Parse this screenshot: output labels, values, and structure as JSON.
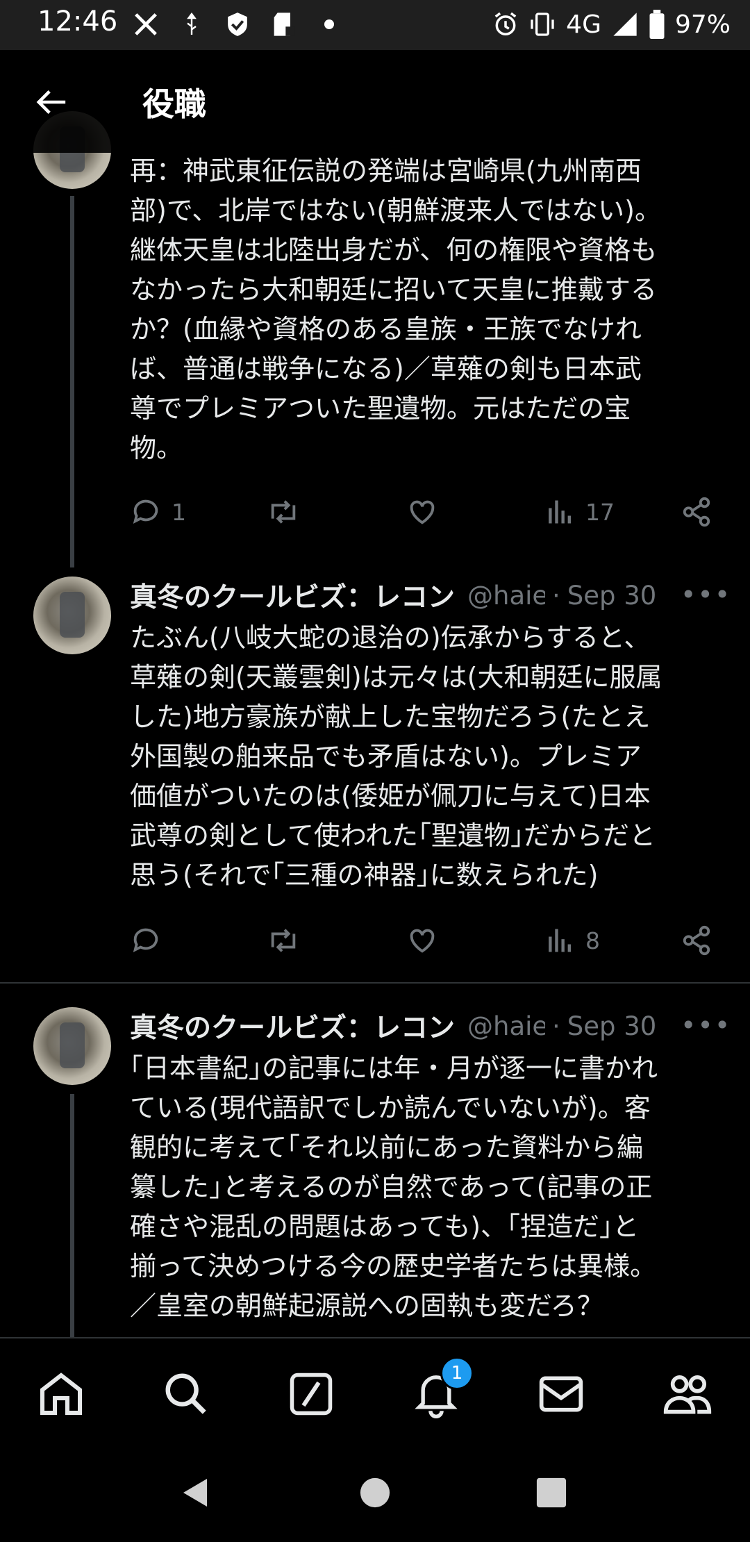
{
  "status_bar": {
    "time": "12:46",
    "network": "4G",
    "battery": "97%",
    "icons": [
      "x-logo-icon",
      "usb-icon",
      "shield-icon",
      "sdcard-icon",
      "dot-icon",
      "alarm-icon",
      "vibrate-icon",
      "signal-icon",
      "battery-icon"
    ]
  },
  "header": {
    "title": "役職",
    "back_icon": "arrow-left-icon"
  },
  "posts": [
    {
      "text": "再：神武東征伝説の発端は宮崎県(九州南西\n部)で、北岸ではない(朝鮮渡来人ではない)。\n継体天皇は北陸出身だが、何の権限や資格も\nなかったら大和朝廷に招いて天皇に推戴する\nか？(血縁や資格のある皇族・王族でなけれ\nば、普通は戦争になる)／草薙の剣も日本武\n尊でプレミアついた聖遺物。元はただの宝\n物。",
      "replies": "1",
      "reposts": "",
      "likes": "",
      "views": "17"
    },
    {
      "author": "真冬のクールビズ：レコン",
      "handle": "@haie",
      "date": "Sep 30",
      "text": "たぶん(八岐大蛇の退治の)伝承からすると、\n草薙の剣(天叢雲剣)は元々は(大和朝廷に服属\nした)地方豪族が献上した宝物だろう(たとえ\n外国製の舶来品でも矛盾はない)。プレミア\n価値がついたのは(倭姫が佩刀に与えて)日本\n武尊の剣として使われた｢聖遺物｣だからだと\n思う(それで｢三種の神器｣に数えられた)",
      "replies": "",
      "reposts": "",
      "likes": "",
      "views": "8"
    },
    {
      "author": "真冬のクールビズ：レコン",
      "handle": "@haie",
      "date": "Sep 30",
      "text": "｢日本書紀｣の記事には年・月が逐一に書かれ\nている(現代語訳でしか読んでいないが)。客\n観的に考えて｢それ以前にあった資料から編\n纂した｣と考えるのが自然であって(記事の正\n確さや混乱の問題はあっても)、｢捏造だ｣と\n揃って決めつける今の歴史学者たちは異様。\n／皇室の朝鮮起源説への固執も変だろ？"
    }
  ],
  "bottom_nav": {
    "items": [
      "home-icon",
      "search-icon",
      "compose-icon",
      "bell-icon",
      "mail-icon",
      "communities-icon"
    ],
    "notification_badge": "1"
  },
  "system_nav": [
    "back-triangle-icon",
    "home-circle-icon",
    "recents-square-icon"
  ],
  "colors": {
    "background": "#000000",
    "text": "#e7e9ea",
    "secondary": "#71767b",
    "accent": "#1d9bf0"
  }
}
